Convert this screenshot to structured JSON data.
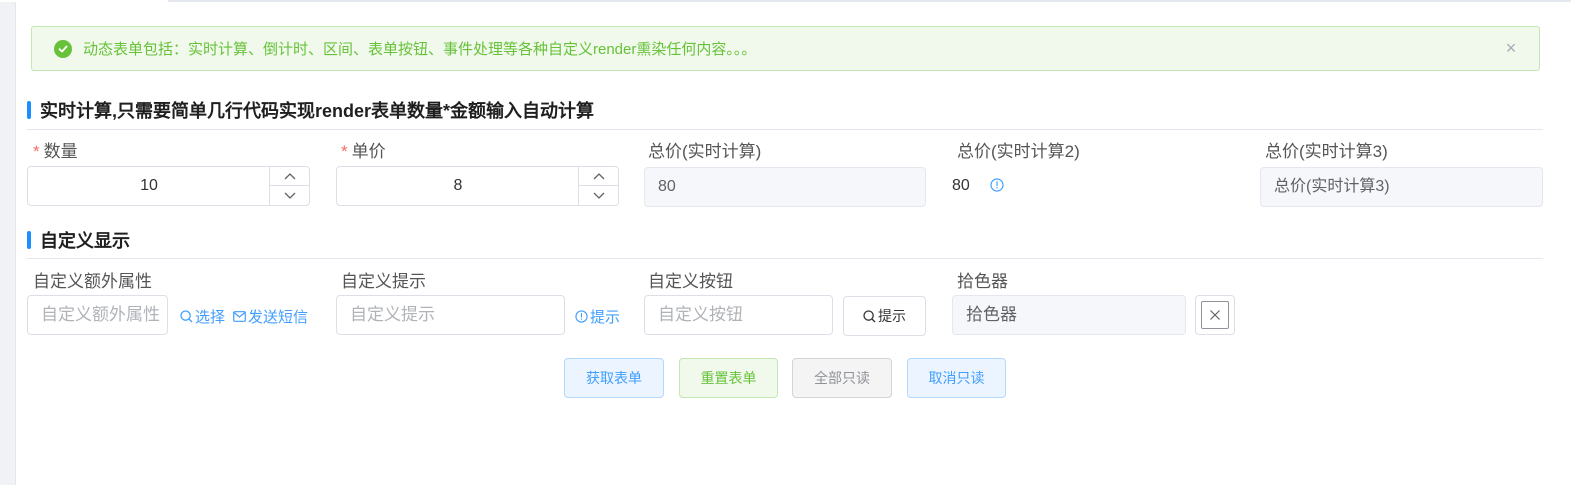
{
  "alert": {
    "text": "动态表单包括：实时计算、倒计时、区间、表单按钮、事件处理等各种自定义render熏染任何内容。。。",
    "close_glyph": "×"
  },
  "section1": {
    "title": "实时计算,只需要简单几行代码实现render表单数量*金额输入自动计算"
  },
  "section2": {
    "title": "自定义显示"
  },
  "fields": {
    "quantity": {
      "required_mark": "*",
      "label": "数量",
      "value": "10"
    },
    "price": {
      "required_mark": "*",
      "label": "单价",
      "value": "8"
    },
    "total1": {
      "label": "总价(实时计算)",
      "value": "80"
    },
    "total2": {
      "label": "总价(实时计算2)",
      "value": "80"
    },
    "total3": {
      "label": "总价(实时计算3)",
      "placeholder": "总价(实时计算3)"
    },
    "extra_attr": {
      "label": "自定义额外属性",
      "placeholder": "自定义额外属性",
      "select_link": "选择",
      "sms_link": "发送短信"
    },
    "custom_tip": {
      "label": "自定义提示",
      "placeholder": "自定义提示",
      "tip_link": "提示"
    },
    "custom_button": {
      "label": "自定义按钮",
      "placeholder": "自定义按钮",
      "button_label": "提示"
    },
    "color_picker": {
      "label": "拾色器",
      "placeholder": "拾色器"
    }
  },
  "actions": {
    "get_form": "获取表单",
    "reset_form": "重置表单",
    "all_readonly": "全部只读",
    "cancel_readonly": "取消只读"
  },
  "colors": {
    "primary": "#409eff",
    "success": "#67c23a",
    "danger": "#f56c6c",
    "section_bar": "#1890ff"
  },
  "icons": {
    "alert": "check-circle-icon",
    "close": "close-icon",
    "spinner_up": "chevron-up-icon",
    "spinner_down": "chevron-down-icon",
    "info": "info-circle-icon",
    "search": "search-icon",
    "message": "mail-icon",
    "color_empty": "close-icon"
  }
}
